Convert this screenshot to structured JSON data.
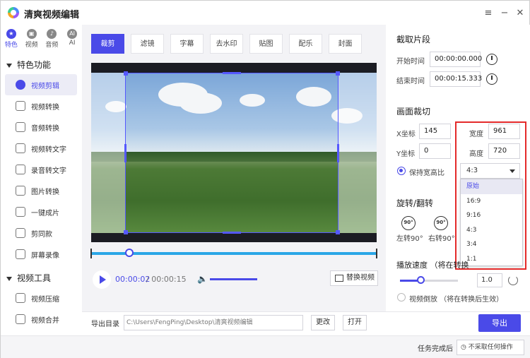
{
  "app": {
    "title": "清爽视频编辑"
  },
  "sidebar": {
    "categories": [
      {
        "label": "特色",
        "icon": "star-icon",
        "glyph": "★"
      },
      {
        "label": "视频",
        "icon": "film-icon",
        "glyph": "▣"
      },
      {
        "label": "音频",
        "icon": "music-icon",
        "glyph": "♪"
      },
      {
        "label": "AI",
        "icon": "ai-icon",
        "glyph": "AI"
      }
    ],
    "group1": "特色功能",
    "items": [
      "视频剪辑",
      "视频转换",
      "音频转换",
      "视频转文字",
      "录音转文字",
      "图片转换",
      "一键成片",
      "剪同款",
      "屏幕录像"
    ],
    "group2": "视频工具",
    "items2": [
      "视频压缩",
      "视频合并"
    ]
  },
  "tabs": [
    "裁剪",
    "滤镜",
    "字幕",
    "去水印",
    "贴图",
    "配乐",
    "封面"
  ],
  "player": {
    "current_time": "00:00:02",
    "total_time": "/ 00:00:15",
    "replace_label": "替换视频"
  },
  "right": {
    "clip_title": "截取片段",
    "start_label": "开始时间",
    "start_value": "00:00:00.000",
    "end_label": "结束时间",
    "end_value": "00:00:15.333",
    "crop_title": "画面裁切",
    "x_label": "X坐标",
    "x_value": "145",
    "y_label": "Y坐标",
    "y_value": "0",
    "w_label": "宽度",
    "w_value": "961",
    "h_label": "高度",
    "h_value": "720",
    "keep_ratio_label": "保持宽高比",
    "ratio_selected": "4:3",
    "ratio_options": [
      "原始",
      "16:9",
      "9:16",
      "4:3",
      "3:4",
      "1:1"
    ],
    "rotate_title": "旋转/翻转",
    "rotate_left": "左转90°",
    "rotate_right": "右转90°",
    "rotate_badge": "90°",
    "speed_title": "播放速度 （将在转换",
    "speed_value": "1.0",
    "speed_fraction": 0.35,
    "reverse_label": "视频倒放 （将在转换后生效）"
  },
  "bottom": {
    "output_label": "导出目录",
    "output_path": "C:\\Users\\FengPing\\Desktop\\清爽视频编辑",
    "change_label": "更改",
    "open_label": "打开",
    "export_label": "导出"
  },
  "status": {
    "after_label": "任务完成后",
    "after_value": "不采取任何操作"
  },
  "colors": {
    "accent": "#4a4ae8",
    "highlight": "#e42a2a",
    "timeline": "#2aa6e6"
  }
}
